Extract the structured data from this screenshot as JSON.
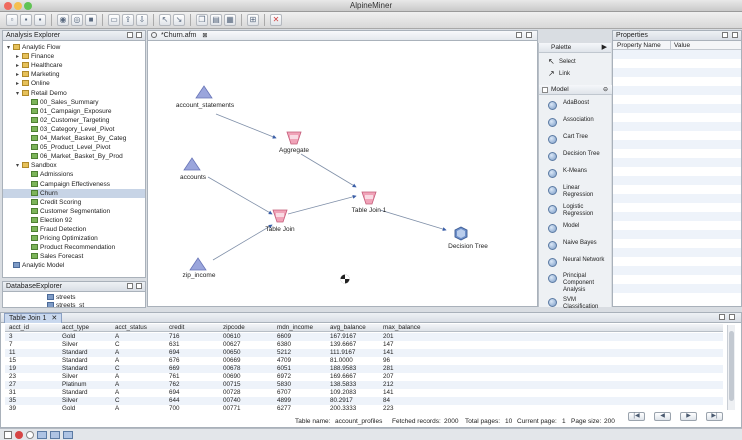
{
  "app": {
    "title": "AlpineMiner"
  },
  "analysis_explorer": {
    "tab_label": "Analysis Explorer",
    "items": [
      {
        "label": "Analytic Flow",
        "level": 0,
        "icon": "folder",
        "expanded": true
      },
      {
        "label": "Finance",
        "level": 1,
        "icon": "folder",
        "expanded": false
      },
      {
        "label": "Healthcare",
        "level": 1,
        "icon": "folder",
        "expanded": false
      },
      {
        "label": "Marketing",
        "level": 1,
        "icon": "folder",
        "expanded": false
      },
      {
        "label": "Online",
        "level": 1,
        "icon": "folder",
        "expanded": false
      },
      {
        "label": "Retail Demo",
        "level": 1,
        "icon": "folder",
        "expanded": true
      },
      {
        "label": "00_Sales_Summary",
        "level": 2,
        "icon": "flow"
      },
      {
        "label": "01_Campaign_Exposure",
        "level": 2,
        "icon": "flow"
      },
      {
        "label": "02_Customer_Targeting",
        "level": 2,
        "icon": "flow"
      },
      {
        "label": "03_Category_Level_Pivot",
        "level": 2,
        "icon": "flow"
      },
      {
        "label": "04_Market_Basket_By_Categ",
        "level": 2,
        "icon": "flow"
      },
      {
        "label": "05_Product_Level_Pivot",
        "level": 2,
        "icon": "flow"
      },
      {
        "label": "06_Market_Basket_By_Prod",
        "level": 2,
        "icon": "flow"
      },
      {
        "label": "Sandbox",
        "level": 1,
        "icon": "folder",
        "expanded": true
      },
      {
        "label": "Admissions",
        "level": 2,
        "icon": "flow"
      },
      {
        "label": "Campaign Effectiveness",
        "level": 2,
        "icon": "flow"
      },
      {
        "label": "Churn",
        "level": 2,
        "icon": "flow",
        "selected": true
      },
      {
        "label": "Credit Scoring",
        "level": 2,
        "icon": "flow"
      },
      {
        "label": "Customer Segmentation",
        "level": 2,
        "icon": "flow"
      },
      {
        "label": "Election 92",
        "level": 2,
        "icon": "flow"
      },
      {
        "label": "Fraud Detection",
        "level": 2,
        "icon": "flow"
      },
      {
        "label": "Pricing Optimization",
        "level": 2,
        "icon": "flow"
      },
      {
        "label": "Product Recommendation",
        "level": 2,
        "icon": "flow"
      },
      {
        "label": "Sales Forecast",
        "level": 2,
        "icon": "flow"
      },
      {
        "label": "Analytic Model",
        "level": 0,
        "icon": "proj"
      }
    ]
  },
  "database_explorer": {
    "tab_label": "DatabaseExplorer",
    "items": [
      "streets",
      "streets_st"
    ]
  },
  "editor": {
    "tab_label": "*Churn.afm",
    "nodes": [
      {
        "id": "account_statements",
        "label": "account_statements",
        "kind": "source"
      },
      {
        "id": "aggregate",
        "label": "Aggregate",
        "kind": "op"
      },
      {
        "id": "accounts",
        "label": "accounts",
        "kind": "source"
      },
      {
        "id": "table_join",
        "label": "Table Join",
        "kind": "op"
      },
      {
        "id": "table_join_1",
        "label": "Table Join 1",
        "kind": "op"
      },
      {
        "id": "zip_income",
        "label": "zip_income",
        "kind": "source"
      },
      {
        "id": "decision_tree",
        "label": "Decision Tree",
        "kind": "model"
      }
    ]
  },
  "palette": {
    "title": "Palette",
    "tools": [
      "Select",
      "Link"
    ],
    "section": "Model",
    "models": [
      "AdaBoost",
      "Association",
      "Cart Tree",
      "Decision Tree",
      "K-Means",
      "Linear Regression",
      "Logistic Regression",
      "Model",
      "Naive Bayes",
      "Neural Network",
      "Principal Component Analysis",
      "SVM Classification"
    ]
  },
  "properties": {
    "tab_label": "Properties",
    "col_name": "Property Name",
    "col_value": "Value"
  },
  "result_panel": {
    "tab_label": "Table Join 1",
    "columns": [
      "acct_id",
      "acct_type",
      "acct_status",
      "credit",
      "zipcode",
      "mdn_income",
      "avg_balance",
      "max_balance"
    ],
    "rows": [
      [
        "3",
        "Gold",
        "A",
        "716",
        "00610",
        "6609",
        "167.9167",
        "201"
      ],
      [
        "7",
        "Silver",
        "C",
        "631",
        "00627",
        "6380",
        "139.6667",
        "147"
      ],
      [
        "11",
        "Standard",
        "A",
        "694",
        "00650",
        "5212",
        "111.9167",
        "141"
      ],
      [
        "15",
        "Standard",
        "A",
        "676",
        "00669",
        "4709",
        "81.0000",
        "96"
      ],
      [
        "19",
        "Standard",
        "C",
        "669",
        "00678",
        "6051",
        "188.9583",
        "281"
      ],
      [
        "23",
        "Silver",
        "A",
        "761",
        "00690",
        "6972",
        "169.6667",
        "207"
      ],
      [
        "27",
        "Platinum",
        "A",
        "762",
        "00715",
        "5830",
        "138.5833",
        "212"
      ],
      [
        "31",
        "Standard",
        "A",
        "694",
        "00728",
        "6707",
        "109.2083",
        "141"
      ],
      [
        "35",
        "Silver",
        "C",
        "644",
        "00740",
        "4899",
        "80.2917",
        "84"
      ],
      [
        "39",
        "Gold",
        "A",
        "700",
        "00771",
        "6277",
        "200.3333",
        "223"
      ]
    ],
    "footer": {
      "table_name_label": "Table name:",
      "table_name": "account_profiles",
      "fetched_label": "Fetched records:",
      "fetched": "2000",
      "total_pages_label": "Total pages:",
      "total_pages": "10",
      "current_page_label": "Current page:",
      "current_page": "1",
      "page_size_label": "Page size:",
      "page_size": "200"
    },
    "nav": [
      "|◀",
      "◀",
      "▶",
      "▶|"
    ]
  },
  "colors": {
    "accent": "#3d6ab3",
    "selection": "#c7d4e6",
    "op_icon": "#e98aa6",
    "source_icon": "#8e9bd4"
  }
}
